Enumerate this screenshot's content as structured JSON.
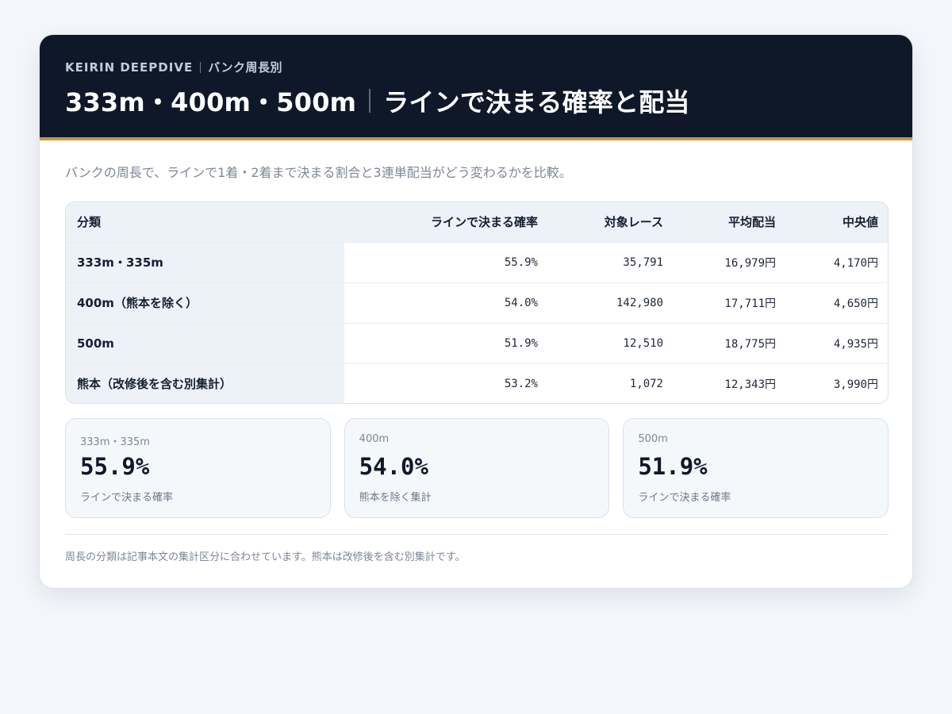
{
  "header": {
    "brand": "KEIRIN DEEPDIVE",
    "section": "バンク周長別",
    "title_lengths": "333m・400m・500m",
    "title_topic": "ラインで決まる確率と配当"
  },
  "lead": "バンクの周長で、ラインで1着・2着まで決まる割合と3連単配当がどう変わるかを比較。",
  "table": {
    "headers": [
      "分類",
      "ラインで決まる確率",
      "対象レース",
      "平均配当",
      "中央値"
    ],
    "rows": [
      [
        "333m・335m",
        "55.9%",
        "35,791",
        "16,979円",
        "4,170円"
      ],
      [
        "400m（熊本を除く）",
        "54.0%",
        "142,980",
        "17,711円",
        "4,650円"
      ],
      [
        "500m",
        "51.9%",
        "12,510",
        "18,775円",
        "4,935円"
      ],
      [
        "熊本（改修後を含む別集計）",
        "53.2%",
        "1,072",
        "12,343円",
        "3,990円"
      ]
    ]
  },
  "stats": [
    {
      "label": "333m・335m",
      "value": "55.9%",
      "note": "ラインで決まる確率"
    },
    {
      "label": "400m",
      "value": "54.0%",
      "note": "熊本を除く集計"
    },
    {
      "label": "500m",
      "value": "51.9%",
      "note": "ラインで決まる確率"
    }
  ],
  "footnote": "周長の分類は記事本文の集計区分に合わせています。熊本は改修後を含む別集計です。",
  "colors": {
    "header_bg": "#0f1829",
    "accent": "#c9953e",
    "page_bg": "#f3f6fa"
  }
}
